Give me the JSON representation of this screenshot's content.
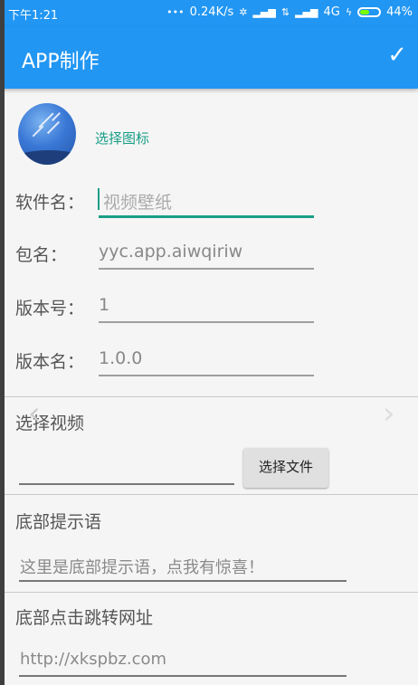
{
  "status_bar": {
    "time": "下午1:21",
    "speed": "0.24K/s",
    "network": "4G",
    "battery": "44%"
  },
  "app_bar": {
    "title": "APP制作"
  },
  "icon_section": {
    "pick_label": "选择图标"
  },
  "fields": [
    {
      "label": "软件名：",
      "value": "视频壁纸"
    },
    {
      "label": "包名：",
      "value": "yyc.app.aiwqiriw"
    },
    {
      "label": "版本号：",
      "value": "1"
    },
    {
      "label": "版本名：",
      "value": "1.0.0"
    }
  ],
  "video": {
    "heading": "选择视频",
    "button": "选择文件"
  },
  "footer_tip": {
    "heading": "底部提示语",
    "placeholder": "这里是底部提示语，点我有惊喜！"
  },
  "footer_link": {
    "heading": "底部点击跳转网址",
    "placeholder": "http://xkspbz.com"
  }
}
